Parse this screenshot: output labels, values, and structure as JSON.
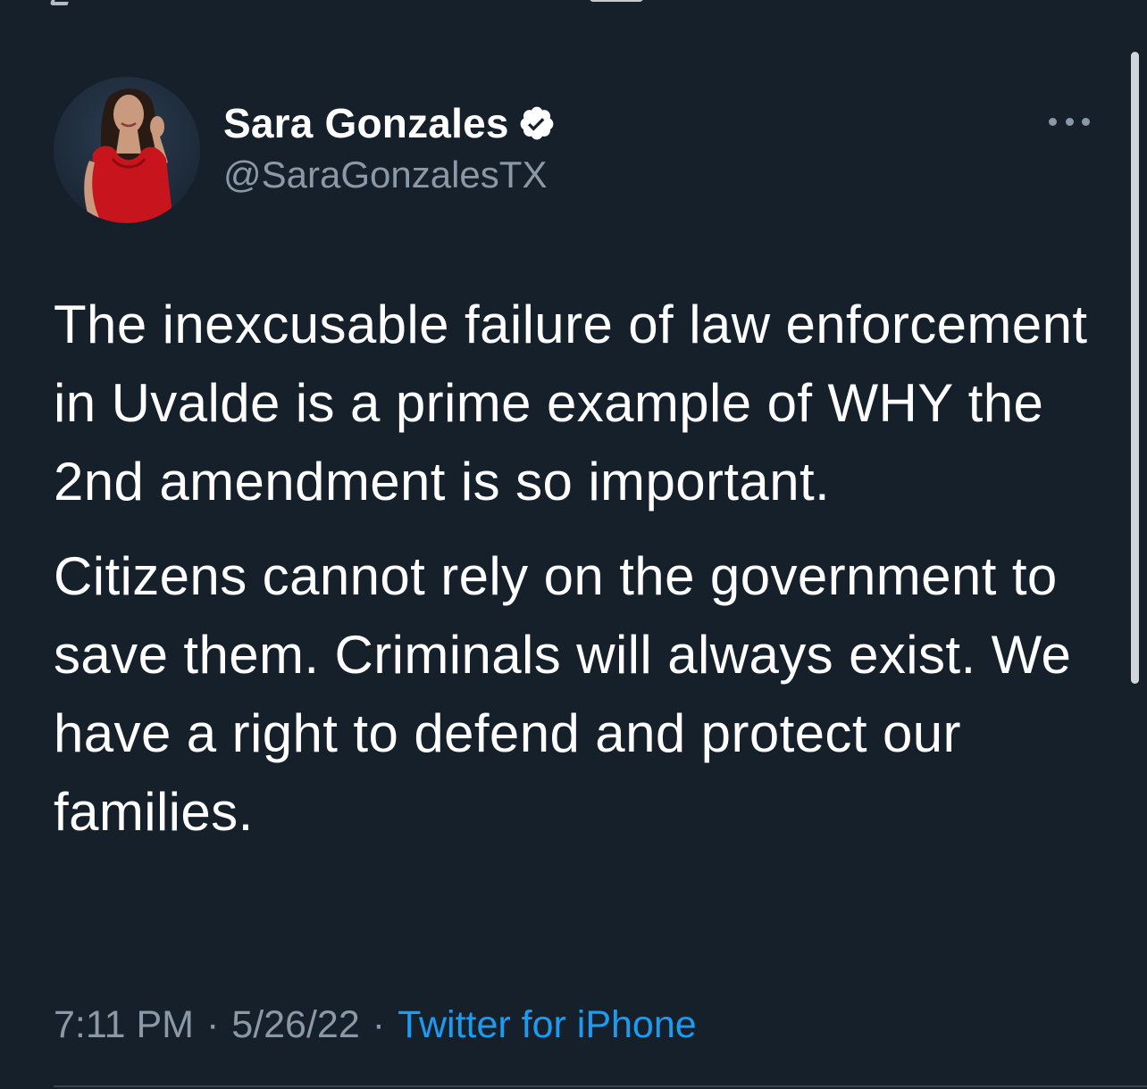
{
  "app": "Twitter",
  "theme_colors": {
    "background": "#15202b",
    "primary_text": "#ffffff",
    "secondary_text": "#8b98a5",
    "link": "#1d9bf0",
    "divider": "#38444d",
    "verified_badge": "#ffffff"
  },
  "tweet": {
    "author": {
      "display_name": "Sara Gonzales",
      "handle": "@SaraGonzalesTX",
      "verified": true,
      "avatar_icon": "profile-photo",
      "badge_icon": "verified-badge-icon"
    },
    "more_icon": "more-options-icon",
    "paragraphs": [
      "The inexcusable failure of law enforcement in Uvalde is a prime example of WHY the 2nd amendment is so important.",
      "Citizens cannot rely on the government to save them. Criminals will always exist. We have a right to defend and protect our families."
    ],
    "time": "7:11 PM",
    "date": "5/26/22",
    "separator": "·",
    "source": "Twitter for iPhone"
  }
}
